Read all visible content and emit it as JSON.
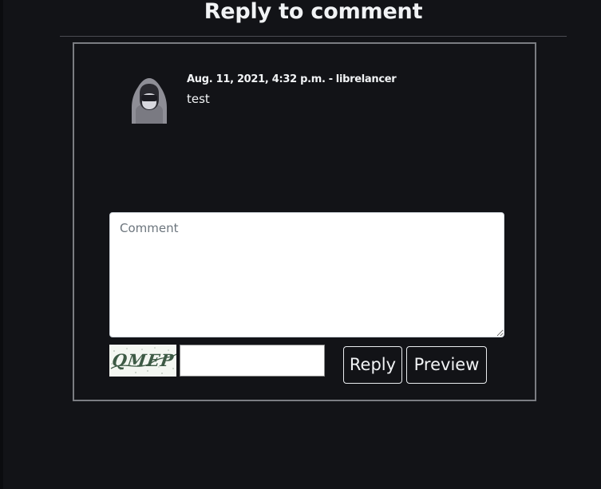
{
  "page": {
    "title": "Reply to comment"
  },
  "comment": {
    "date": "Aug. 11, 2021, 4:32 p.m.",
    "separator": "-",
    "author": "librelancer",
    "text": "test",
    "avatar_icon": "hooded-user-icon"
  },
  "form": {
    "comment_placeholder": "Comment",
    "comment_value": "",
    "captcha_text": "QMEP",
    "captcha_value": "",
    "reply_label": "Reply",
    "preview_label": "Preview"
  },
  "colors": {
    "background": "#121317",
    "text": "#f1f3f5",
    "card_border": "#7b7d82",
    "button_border": "#e9ecef"
  }
}
